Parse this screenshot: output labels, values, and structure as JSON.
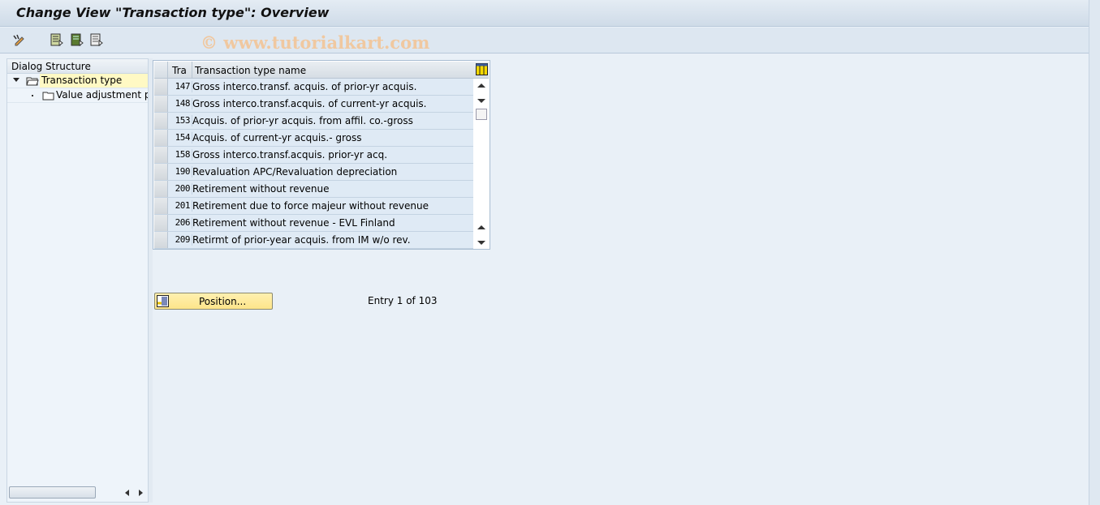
{
  "title": "Change View \"Transaction type\": Overview",
  "watermark": "© www.tutorialkart.com",
  "toolbar": {
    "icons": [
      "edit-glasses-icon",
      "select-all-icon",
      "select-block-icon",
      "deselect-all-icon"
    ]
  },
  "dialog_structure": {
    "header": "Dialog Structure",
    "nodes": [
      {
        "label": "Transaction type",
        "selected": true,
        "expanded": true
      },
      {
        "label": "Value adjustment pro",
        "selected": false
      }
    ]
  },
  "table": {
    "columns": [
      "Tra",
      "Transaction type name"
    ],
    "rows": [
      {
        "key": "147",
        "name": "Gross interco.transf. acquis. of prior-yr acquis."
      },
      {
        "key": "148",
        "name": "Gross interco.transf.acquis. of current-yr acquis."
      },
      {
        "key": "153",
        "name": "Acquis. of prior-yr acquis. from affil. co.-gross"
      },
      {
        "key": "154",
        "name": "Acquis. of current-yr acquis.- gross"
      },
      {
        "key": "158",
        "name": "Gross interco.transf.acquis. prior-yr acq."
      },
      {
        "key": "190",
        "name": "Revaluation APC/Revaluation depreciation"
      },
      {
        "key": "200",
        "name": "Retirement without revenue"
      },
      {
        "key": "201",
        "name": "Retirement due to force majeur without revenue"
      },
      {
        "key": "206",
        "name": "Retirement without revenue - EVL Finland"
      },
      {
        "key": "209",
        "name": "Retirmt of prior-year acquis. from IM w/o rev."
      }
    ]
  },
  "position_button": "Position...",
  "entry_info": "Entry 1 of 103",
  "colors": {
    "selected_node": "#fff9c4",
    "button": "#fde58a",
    "background": "#e9f0f7"
  }
}
